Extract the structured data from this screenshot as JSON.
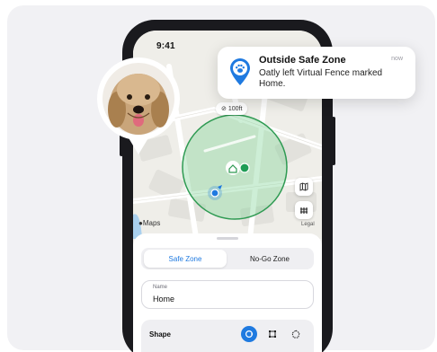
{
  "status_bar": {
    "time": "9:41"
  },
  "map": {
    "scale_label": "100ft",
    "maps_attribution": "Maps",
    "legal_label": "Legal",
    "map_button_icon": "map-icon",
    "layers_button_icon": "fence-icon"
  },
  "notification": {
    "title": "Outside Safe Zone",
    "body": "Oatly left Virtual Fence marked Home.",
    "time": "now",
    "icon": "paw-pin-icon"
  },
  "sheet": {
    "tabs": [
      {
        "label": "Safe Zone",
        "active": true
      },
      {
        "label": "No-Go Zone",
        "active": false
      }
    ],
    "name_field": {
      "label": "Name",
      "value": "Home"
    },
    "shape": {
      "label": "Shape",
      "options": [
        "circle-icon",
        "square-icon",
        "polygon-icon"
      ],
      "selected": "circle-icon"
    }
  },
  "colors": {
    "accent": "#1f7ae0",
    "zone_fill": "#6fcf8a",
    "zone_stroke": "#2e9a52"
  }
}
